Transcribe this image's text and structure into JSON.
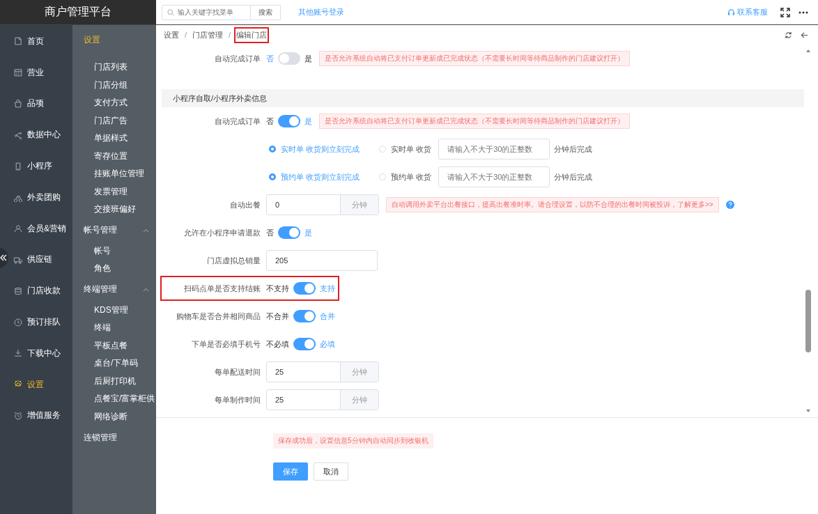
{
  "header": {
    "title": "商户管理平台",
    "search": {
      "placeholder": "输入关键字找菜单",
      "button": "搜索"
    },
    "link": "其他账号登录",
    "support": "联系客服"
  },
  "nav": [
    {
      "label": "首页",
      "selected": false
    },
    {
      "label": "营业",
      "selected": false
    },
    {
      "label": "品项",
      "selected": false
    },
    {
      "label": "数据中心",
      "selected": false
    },
    {
      "label": "小程序",
      "selected": false
    },
    {
      "label": "外卖团购",
      "selected": false
    },
    {
      "label": "会员&营销",
      "selected": false
    },
    {
      "label": "供应链",
      "selected": false
    },
    {
      "label": "门店收款",
      "selected": false
    },
    {
      "label": "预订排队",
      "selected": false
    },
    {
      "label": "下载中心",
      "selected": false
    },
    {
      "label": "设置",
      "selected": true
    },
    {
      "label": "增值服务",
      "selected": false
    }
  ],
  "submenu": [
    {
      "kind": "title",
      "label": "设置",
      "selected": true,
      "expanded": true,
      "children": [
        {
          "label": "门店列表",
          "selected": false
        },
        {
          "label": "门店分组",
          "selected": false
        },
        {
          "label": "支付方式",
          "selected": false
        },
        {
          "label": "门店广告",
          "selected": false
        },
        {
          "label": "单据样式",
          "selected": false
        },
        {
          "label": "寄存位置",
          "selected": false
        },
        {
          "label": "挂账单位管理",
          "selected": false
        },
        {
          "label": "发票管理",
          "selected": false
        },
        {
          "label": "交接班偏好",
          "selected": false
        }
      ]
    },
    {
      "kind": "group",
      "label": "帐号管理",
      "selected": false,
      "expanded": true,
      "children": [
        {
          "label": "帐号",
          "selected": false
        },
        {
          "label": "角色",
          "selected": false
        }
      ]
    },
    {
      "kind": "group",
      "label": "终端管理",
      "selected": false,
      "expanded": true,
      "children": [
        {
          "label": "KDS管理",
          "selected": false
        },
        {
          "label": "终端",
          "selected": false
        },
        {
          "label": "平板点餐",
          "selected": false
        },
        {
          "label": "桌台/下单码",
          "selected": false
        },
        {
          "label": "后厨打印机",
          "selected": false
        },
        {
          "label": "点餐宝/富掌柜供",
          "selected": false
        },
        {
          "label": "网络诊断",
          "selected": false
        }
      ]
    },
    {
      "kind": "link",
      "label": "连锁管理",
      "selected": false
    }
  ],
  "breadcrumb": {
    "separator": "/",
    "items": [
      {
        "label": "设置",
        "highlighted": false
      },
      {
        "label": "门店管理",
        "highlighted": false
      },
      {
        "label": "编辑门店",
        "highlighted": true
      }
    ]
  },
  "form": [
    {
      "kind": "toggle",
      "label": "自动完成订单",
      "off_label": "否",
      "on_label": "是",
      "on": false,
      "hint": "是否允许系统自动将已支付订单更新成已完成状态（不需要长时间等待商品制作的门店建议打开）"
    },
    {
      "kind": "section",
      "title": "小程序自取/小程序外卖信息"
    },
    {
      "kind": "toggle",
      "label": "自动完成订单",
      "off_label": "否",
      "on_label": "是",
      "on": true,
      "hint": "是否允许系统自动将已支付订单更新成已完成状态（不需要长时间等待商品制作的门店建议打开）"
    },
    {
      "kind": "radio",
      "options": [
        {
          "label": "实时单 收货则立刻完成",
          "selected": true
        },
        {
          "label": "实时单 收货",
          "selected": false,
          "placeholder": "请输入不大于30的正整数",
          "suffix": "分钟后完成"
        }
      ]
    },
    {
      "kind": "radio",
      "options": [
        {
          "label": "预约单 收货则立刻完成",
          "selected": true
        },
        {
          "label": "预约单 收货",
          "selected": false,
          "placeholder": "请输入不大于30的正整数",
          "suffix": "分钟后完成"
        }
      ]
    },
    {
      "kind": "input-unit",
      "label": "自动出餐",
      "value": "0",
      "unit": "分钟",
      "hint": "自动调用外卖平台出餐接口，提高出餐准时率。请合理设置，以防不合理的出餐时间被投诉，了解更多>>",
      "help": true
    },
    {
      "kind": "toggle",
      "label": "允许在小程序申请退款",
      "off_label": "否",
      "on_label": "是",
      "on": true
    },
    {
      "kind": "input",
      "label": "门店虚拟总销量",
      "value": "205"
    },
    {
      "kind": "toggle",
      "label": "扫码点单是否支持结账",
      "off_label": "不支持",
      "on_label": "支持",
      "on": true,
      "highlighted": true
    },
    {
      "kind": "toggle",
      "label": "购物车是否合并相同商品",
      "off_label": "不合并",
      "on_label": "合并",
      "on": true
    },
    {
      "kind": "toggle",
      "label": "下单是否必填手机号",
      "off_label": "不必填",
      "on_label": "必填",
      "on": true
    },
    {
      "kind": "input-unit",
      "label": "每单配送时间",
      "value": "25",
      "unit": "分钟"
    },
    {
      "kind": "input-unit",
      "label": "每单制作时间",
      "value": "25",
      "unit": "分钟"
    }
  ],
  "notice": "保存成功后，设置信息5分钟内自动同步到收银机",
  "buttons": [
    {
      "label": "保存",
      "kind": "primary"
    },
    {
      "label": "取消",
      "kind": "default"
    }
  ]
}
